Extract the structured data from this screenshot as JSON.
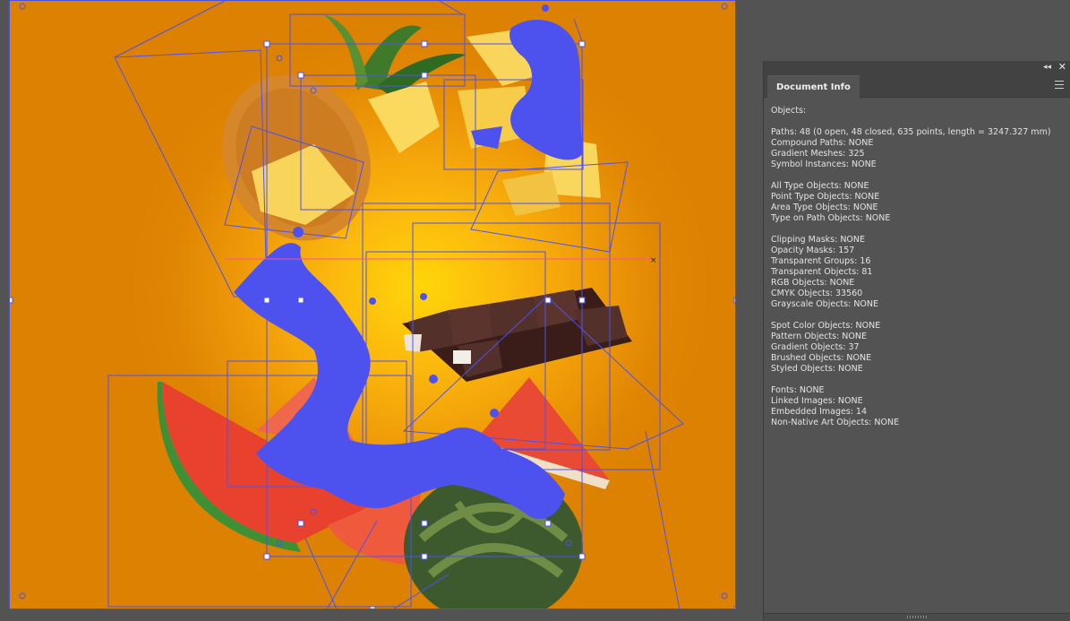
{
  "panel": {
    "tab_label": "Document Info",
    "icons": {
      "collapse": "double-chevron-left-icon",
      "close": "close-icon",
      "menu": "hamburger-menu-icon",
      "grip": "resize-grip-icon"
    },
    "collapse_glyph": "◂◂",
    "close_glyph": "✕",
    "lines": [
      "Objects:",
      "",
      "Paths: 48 (0 open, 48 closed, 635 points, length = 3247.327 mm)",
      "Compound Paths: NONE",
      "Gradient Meshes: 325",
      "Symbol Instances: NONE",
      "",
      "All Type Objects: NONE",
      "Point Type Objects: NONE",
      "Area Type Objects: NONE",
      "Type on Path Objects: NONE",
      "",
      "Clipping Masks: NONE",
      "Opacity Masks: 157",
      "Transparent Groups: 16",
      "Transparent Objects: 81",
      "RGB Objects: NONE",
      "CMYK Objects: 33560",
      "Grayscale Objects: NONE",
      "",
      "Spot Color Objects: NONE",
      "Pattern Objects: NONE",
      "Gradient Objects: 37",
      "Brushed Objects: NONE",
      "Styled Objects: NONE",
      "",
      "Fonts: NONE",
      "Linked Images: NONE",
      "Embedded Images: 14",
      "Non-Native Art Objects: NONE"
    ]
  },
  "colors": {
    "selection": "#4d52ef",
    "background_orange": "#dc8102",
    "background_yellow": "#ffd60a",
    "guide": "#ff4fa0"
  }
}
